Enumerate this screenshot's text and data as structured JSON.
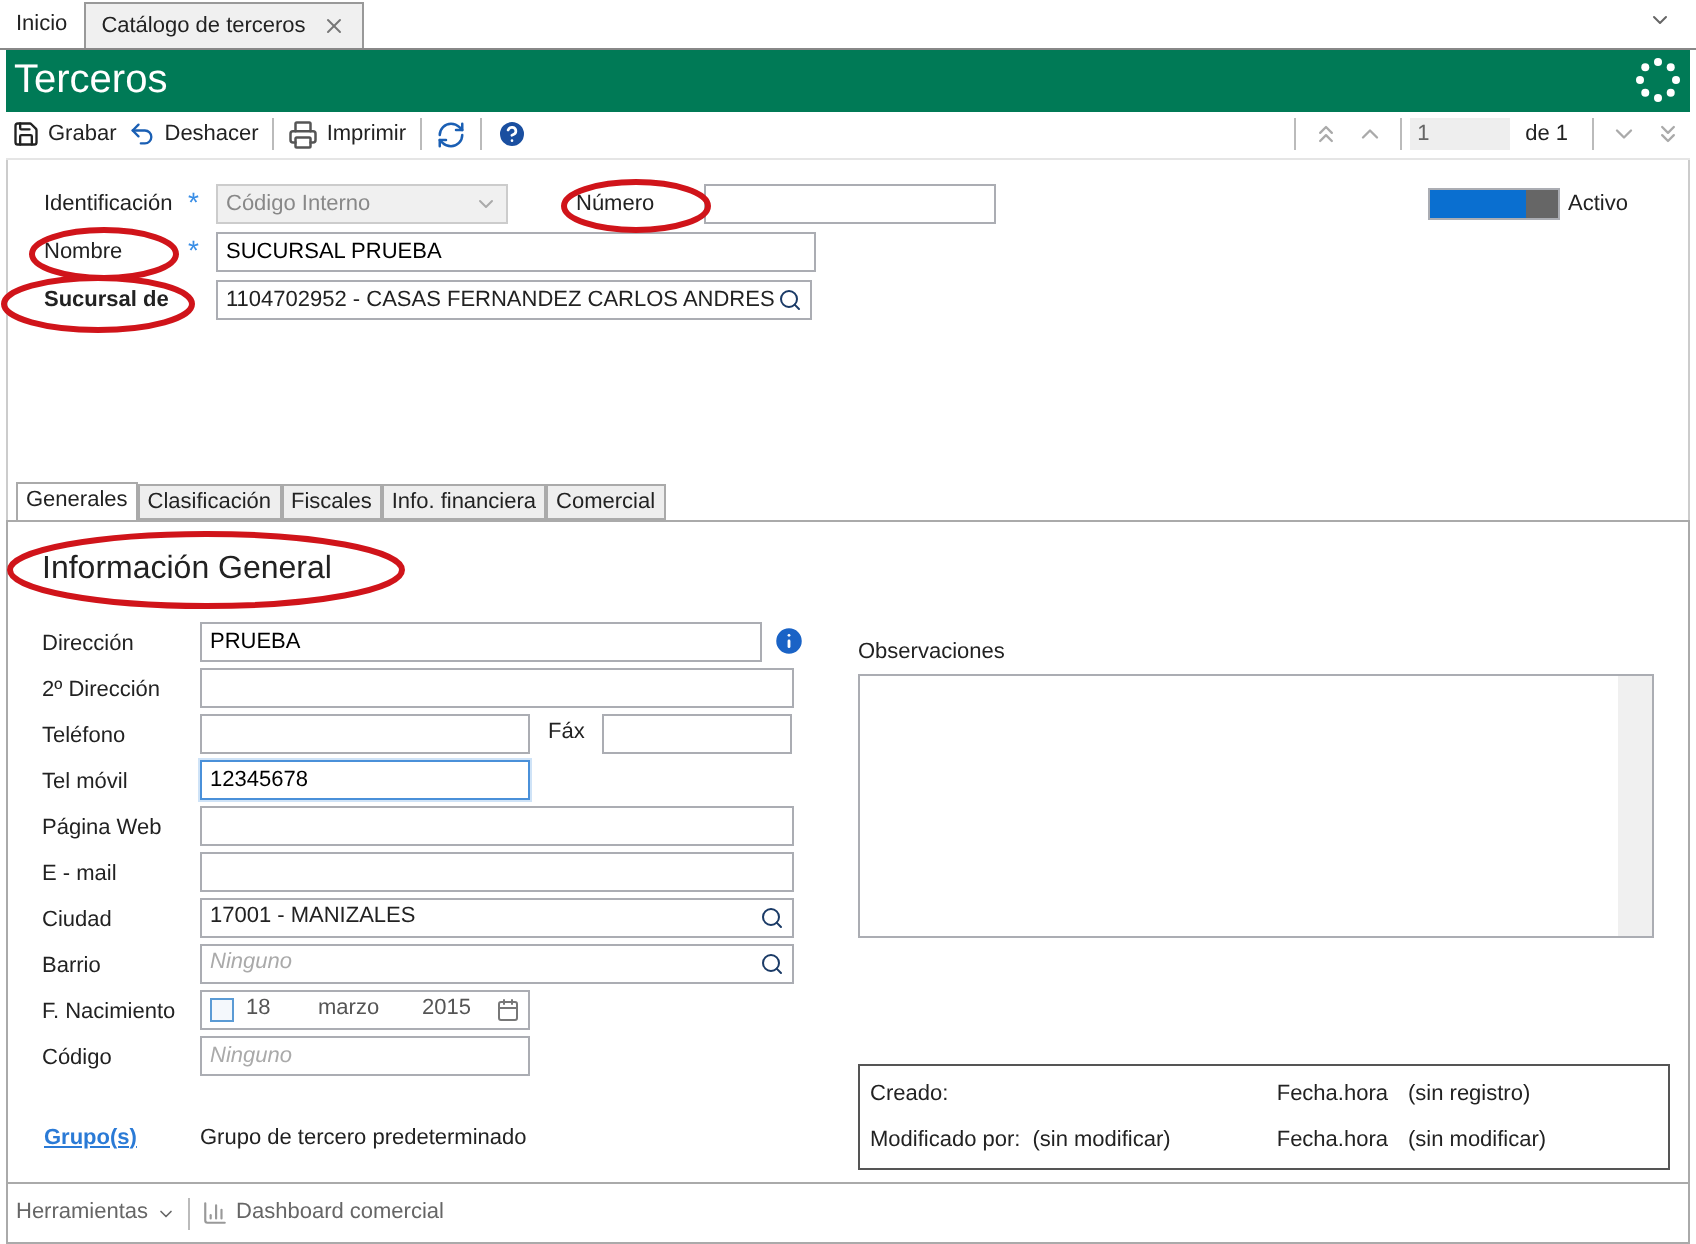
{
  "doc_tabs": [
    {
      "label": "Inicio",
      "selected": false,
      "closable": false
    },
    {
      "label": "Catálogo de terceros",
      "selected": true,
      "closable": true
    }
  ],
  "header": {
    "title": "Terceros"
  },
  "toolbar": {
    "buttons": [
      {
        "label": "Grabar",
        "kind": "save"
      },
      {
        "label": "Deshacer",
        "kind": "undo"
      },
      {
        "label": "Imprimir",
        "kind": "print"
      },
      {
        "kind": "refresh"
      },
      {
        "kind": "help"
      }
    ],
    "pager": {
      "value": "1",
      "total": "de 1"
    }
  },
  "top_form": {
    "id_type": {
      "label": "Identificación",
      "required_mark": "*",
      "value": "Código Interno",
      "disabled": true
    },
    "number": {
      "label": "Número",
      "highlighted": true
    },
    "name": {
      "label": "Nombre",
      "required_mark": "*",
      "value": "SUCURSAL PRUEBA",
      "highlighted": true
    },
    "branch_of": {
      "label": "Sucursal de",
      "value": "1104702952 - CASAS FERNANDEZ CARLOS ANDRES",
      "highlighted": true
    },
    "active": {
      "label": "Activo",
      "on": true
    }
  },
  "section_tabs": [
    {
      "label": "Generales",
      "selected": true
    },
    {
      "label": "Clasificación",
      "selected": false
    },
    {
      "label": "Fiscales",
      "selected": false
    },
    {
      "label": "Info. financiera",
      "selected": false
    },
    {
      "label": "Comercial",
      "selected": false
    }
  ],
  "section": {
    "title": "Información General",
    "highlighted": true,
    "fields": [
      {
        "label": "Dirección",
        "kind": "text",
        "value": "PRUEBA",
        "info": true
      },
      {
        "label": "2º Dirección",
        "kind": "text"
      },
      {
        "label": "Teléfono",
        "kind": "phone",
        "fax_label": "Fáx"
      },
      {
        "label": "Tel móvil",
        "kind": "short",
        "value": "12345678",
        "focused": true
      },
      {
        "label": "Página Web",
        "kind": "text"
      },
      {
        "label": "E - mail",
        "kind": "text"
      },
      {
        "label": "Ciudad",
        "kind": "lookup",
        "value": "17001 - MANIZALES"
      },
      {
        "label": "Barrio",
        "kind": "lookup",
        "placeholder": "Ninguno"
      },
      {
        "label": "F. Nacimiento",
        "kind": "date",
        "checked": false,
        "day": "18",
        "month": "marzo",
        "year": "2015"
      },
      {
        "label": "Código",
        "kind": "short",
        "placeholder": "Ninguno"
      }
    ],
    "notes_label": "Observaciones",
    "groups": {
      "link": "Grupo(s)",
      "value": "Grupo de tercero predeterminado"
    },
    "audit": [
      {
        "label": "Creado:",
        "date_label": "Fecha.hora",
        "date_value": "(sin registro)"
      },
      {
        "label": "Modificado por:",
        "value": "(sin modificar)",
        "date_label": "Fecha.hora",
        "date_value": "(sin modificar)"
      }
    ]
  },
  "footer": {
    "tools": "Herramientas",
    "dashboard": "Dashboard comercial"
  }
}
